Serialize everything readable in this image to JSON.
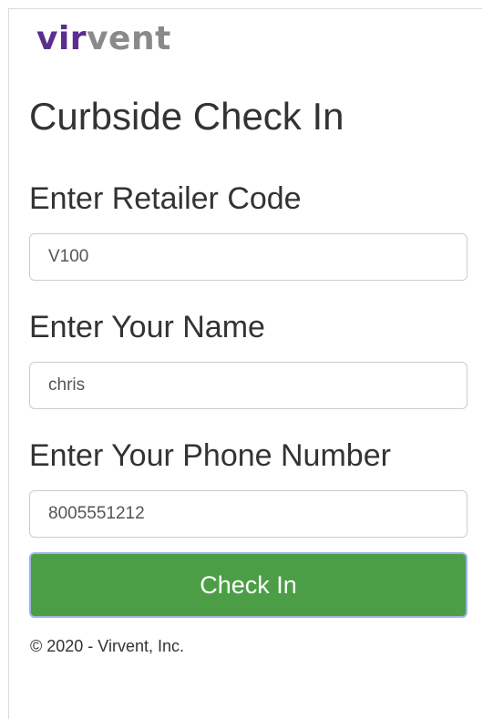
{
  "brand": {
    "logo_text": "virvent",
    "logo_purple_letters": "vir",
    "logo_gray_letters": "vent",
    "colors": {
      "purple": "#5b2d8e",
      "gray": "#8a8a8a"
    }
  },
  "page": {
    "title": "Curbside Check In"
  },
  "form": {
    "retailer_code": {
      "label": "Enter Retailer Code",
      "value": "V100"
    },
    "name": {
      "label": "Enter Your Name",
      "value": "chris"
    },
    "phone": {
      "label": "Enter Your Phone Number",
      "value": "8005551212"
    },
    "submit_label": "Check In",
    "submit_color": "#4b9e46"
  },
  "footer": {
    "copyright": "© 2020 - Virvent, Inc."
  }
}
